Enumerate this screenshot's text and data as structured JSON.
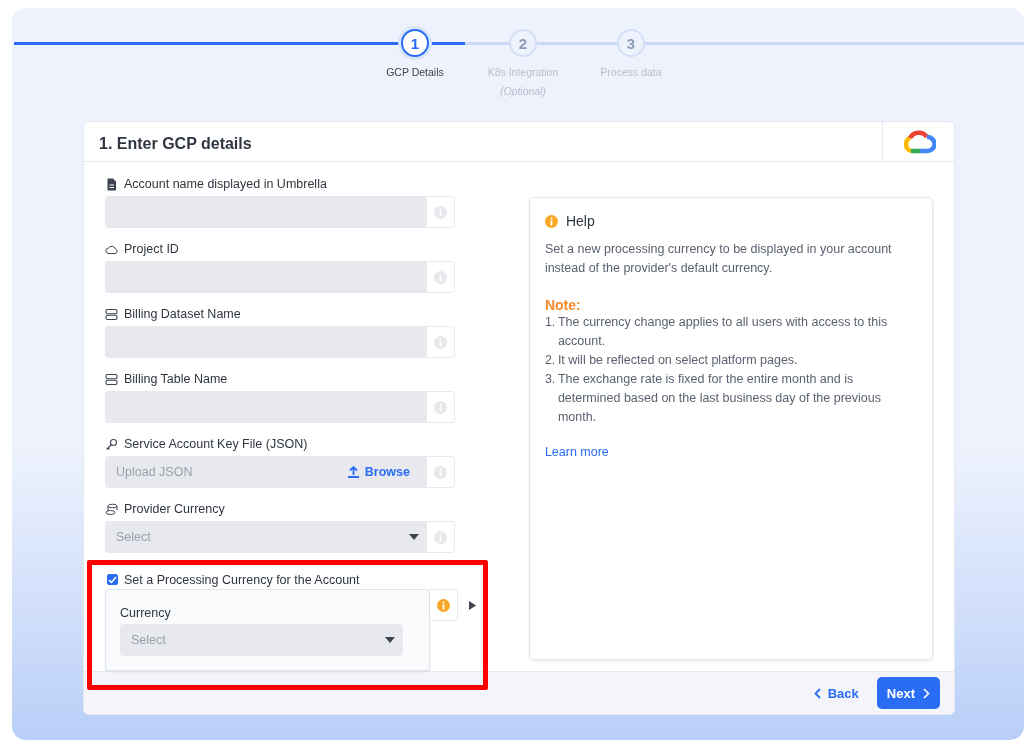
{
  "steps": [
    {
      "number": "1",
      "label": "GCP Details",
      "selected": true
    },
    {
      "number": "2",
      "label": "K8s Integration",
      "note": "(Optional)",
      "selected": false
    },
    {
      "number": "3",
      "label": "Process data",
      "selected": false
    }
  ],
  "card": {
    "title": "1. Enter GCP details"
  },
  "fields": [
    {
      "kind": "text",
      "label": "Account name displayed in Umbrella"
    },
    {
      "kind": "text",
      "label": "Project ID"
    },
    {
      "kind": "text",
      "label": "Billing Dataset Name"
    },
    {
      "kind": "text",
      "label": "Billing Table Name"
    },
    {
      "kind": "upload",
      "label": "Service Account Key File (JSON)",
      "placeholder": "Upload JSON",
      "action": "Browse"
    },
    {
      "kind": "select",
      "label": "Provider Currency",
      "placeholder": "Select"
    }
  ],
  "processing": {
    "label": "Set a Processing Currency for the Account",
    "checked": true,
    "currency_label": "Currency",
    "currency_placeholder": "Select"
  },
  "help": {
    "title": "Help",
    "text": "Set a new processing currency to be displayed in your account instead of the provider's default currency.",
    "note_title": "Note:",
    "notes": [
      {
        "number": "1.",
        "text": "The currency change applies to all users with access to this account."
      },
      {
        "number": "2.",
        "text": "It will be reflected on select platform pages."
      },
      {
        "number": "3.",
        "text": "The exchange rate is fixed for the entire month and is determined based on the last business day of the previous month."
      }
    ],
    "link": "Learn more"
  },
  "footer": {
    "back": "Back",
    "next": "Next"
  }
}
